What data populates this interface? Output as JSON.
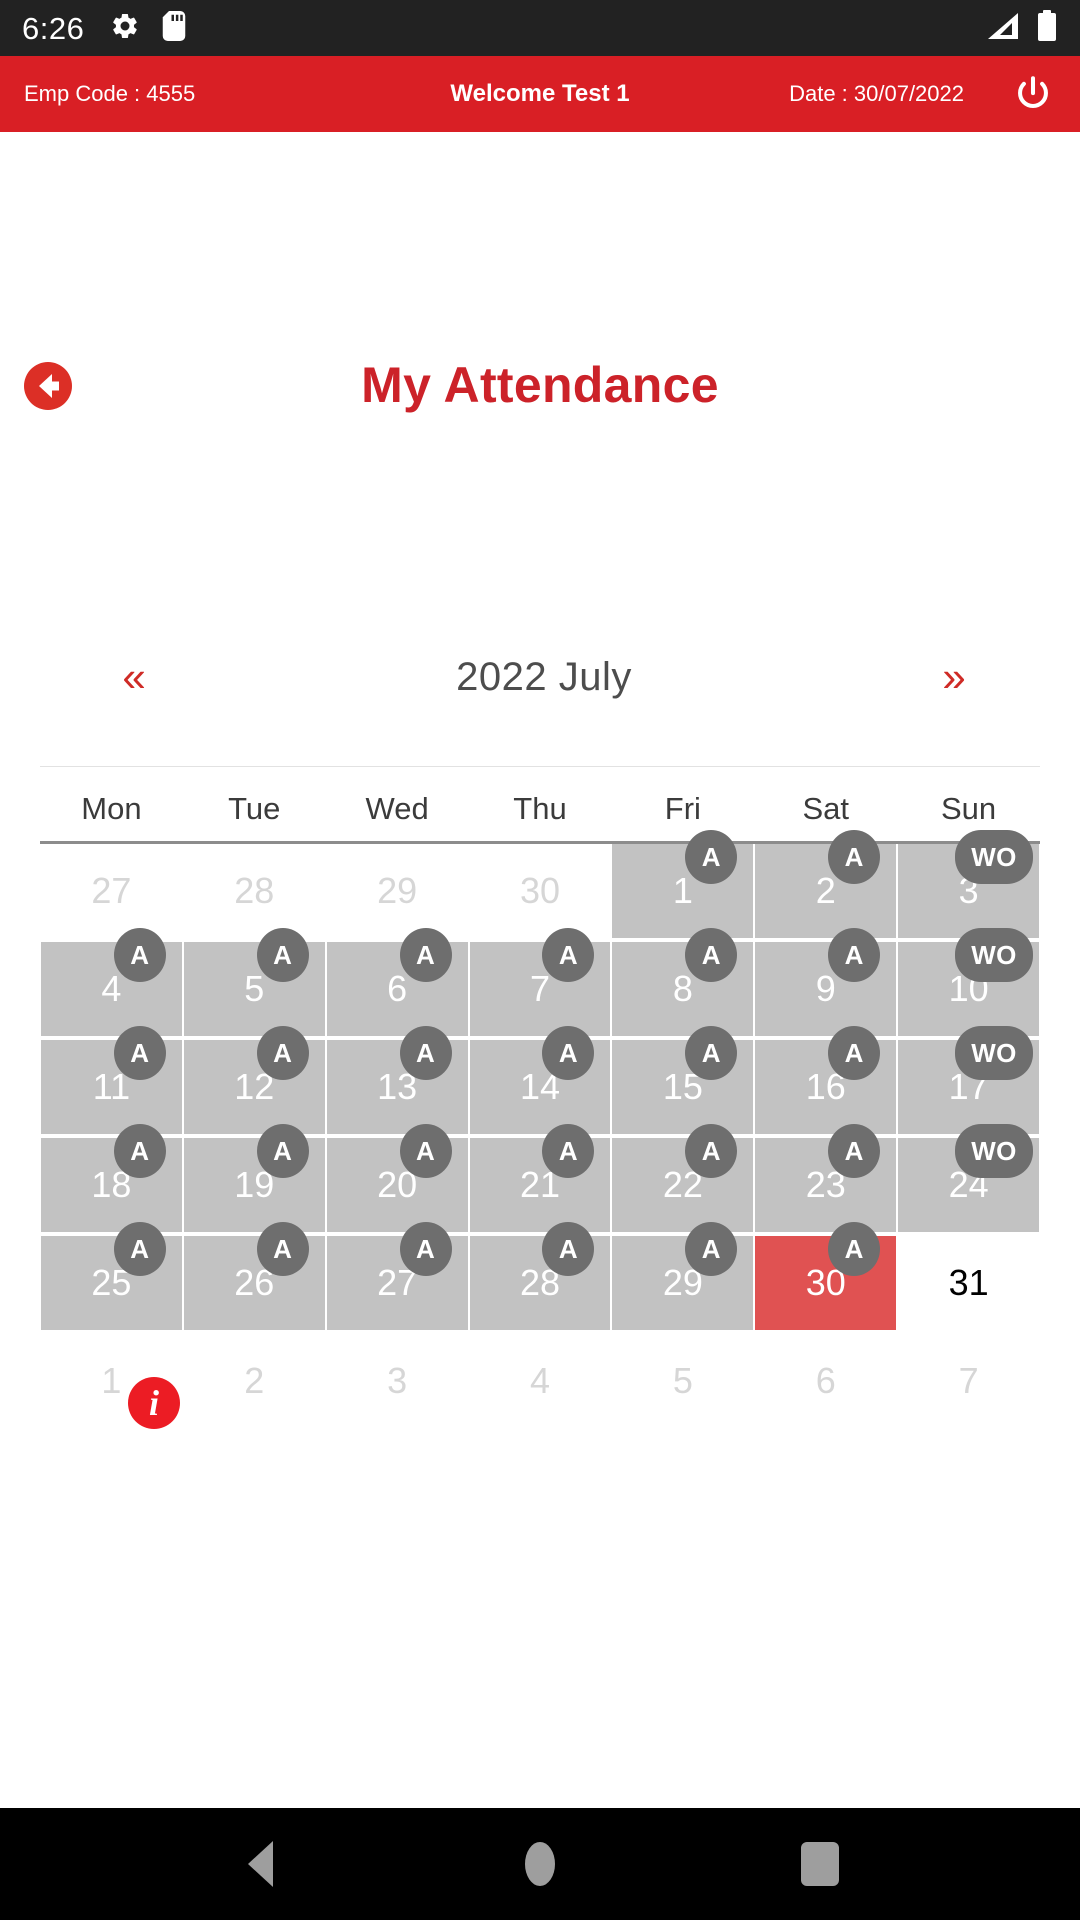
{
  "status_bar": {
    "time": "6:26",
    "icons_left": [
      "gear-icon",
      "sd-card-icon"
    ],
    "icons_right": [
      "signal-icon",
      "battery-icon"
    ],
    "background": "#222222"
  },
  "app_bar": {
    "emp_code": "Emp Code : 4555",
    "welcome": "Welcome Test 1",
    "date": "Date : 30/07/2022",
    "power_icon": "power-icon",
    "background": "#d91f25"
  },
  "page": {
    "back_icon": "back-arrow-circle-icon",
    "title": "My Attendance",
    "title_color": "#cc2229"
  },
  "calendar": {
    "prev_label": "«",
    "next_label": "»",
    "month_title": "2022 July",
    "weekdays": [
      "Mon",
      "Tue",
      "Wed",
      "Thu",
      "Fri",
      "Sat",
      "Sun"
    ],
    "marked_color": "#c2c2c2",
    "today_color": "#e05252",
    "badge_color": "#6e6e6e",
    "weeks": [
      [
        {
          "day": "27",
          "state": "muted",
          "badge": ""
        },
        {
          "day": "28",
          "state": "muted",
          "badge": ""
        },
        {
          "day": "29",
          "state": "muted",
          "badge": ""
        },
        {
          "day": "30",
          "state": "muted",
          "badge": ""
        },
        {
          "day": "1",
          "state": "marked",
          "badge": "A"
        },
        {
          "day": "2",
          "state": "marked",
          "badge": "A"
        },
        {
          "day": "3",
          "state": "marked",
          "badge": "WO"
        }
      ],
      [
        {
          "day": "4",
          "state": "marked",
          "badge": "A"
        },
        {
          "day": "5",
          "state": "marked",
          "badge": "A"
        },
        {
          "day": "6",
          "state": "marked",
          "badge": "A"
        },
        {
          "day": "7",
          "state": "marked",
          "badge": "A"
        },
        {
          "day": "8",
          "state": "marked",
          "badge": "A"
        },
        {
          "day": "9",
          "state": "marked",
          "badge": "A"
        },
        {
          "day": "10",
          "state": "marked",
          "badge": "WO"
        }
      ],
      [
        {
          "day": "11",
          "state": "marked",
          "badge": "A"
        },
        {
          "day": "12",
          "state": "marked",
          "badge": "A"
        },
        {
          "day": "13",
          "state": "marked",
          "badge": "A"
        },
        {
          "day": "14",
          "state": "marked",
          "badge": "A"
        },
        {
          "day": "15",
          "state": "marked",
          "badge": "A"
        },
        {
          "day": "16",
          "state": "marked",
          "badge": "A"
        },
        {
          "day": "17",
          "state": "marked",
          "badge": "WO"
        }
      ],
      [
        {
          "day": "18",
          "state": "marked",
          "badge": "A"
        },
        {
          "day": "19",
          "state": "marked",
          "badge": "A"
        },
        {
          "day": "20",
          "state": "marked",
          "badge": "A"
        },
        {
          "day": "21",
          "state": "marked",
          "badge": "A"
        },
        {
          "day": "22",
          "state": "marked",
          "badge": "A"
        },
        {
          "day": "23",
          "state": "marked",
          "badge": "A"
        },
        {
          "day": "24",
          "state": "marked",
          "badge": "WO"
        }
      ],
      [
        {
          "day": "25",
          "state": "marked",
          "badge": "A"
        },
        {
          "day": "26",
          "state": "marked",
          "badge": "A"
        },
        {
          "day": "27",
          "state": "marked",
          "badge": "A"
        },
        {
          "day": "28",
          "state": "marked",
          "badge": "A"
        },
        {
          "day": "29",
          "state": "marked",
          "badge": "A"
        },
        {
          "day": "30",
          "state": "today",
          "badge": "A"
        },
        {
          "day": "31",
          "state": "plain",
          "badge": ""
        }
      ],
      [
        {
          "day": "1",
          "state": "muted",
          "badge": ""
        },
        {
          "day": "2",
          "state": "muted",
          "badge": ""
        },
        {
          "day": "3",
          "state": "muted",
          "badge": ""
        },
        {
          "day": "4",
          "state": "muted",
          "badge": ""
        },
        {
          "day": "5",
          "state": "muted",
          "badge": ""
        },
        {
          "day": "6",
          "state": "muted",
          "badge": ""
        },
        {
          "day": "7",
          "state": "muted",
          "badge": ""
        }
      ]
    ]
  },
  "info_button": {
    "label": "i",
    "icon": "info-icon",
    "color": "#ec1c24"
  },
  "nav_bar": {
    "items": [
      "back-nav-icon",
      "home-nav-icon",
      "recents-nav-icon"
    ],
    "background": "#000000"
  }
}
